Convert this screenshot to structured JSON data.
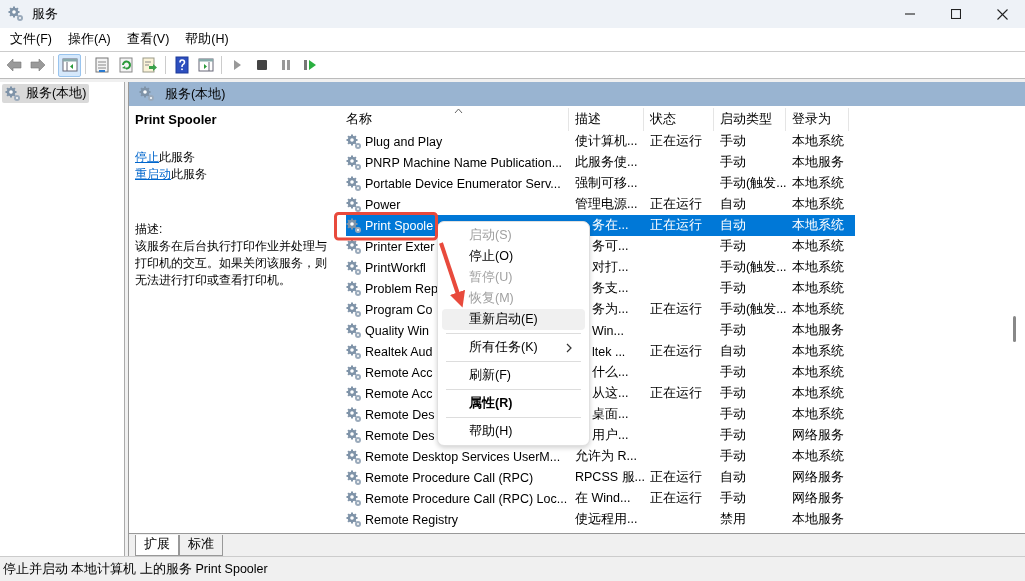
{
  "window": {
    "title": "服务"
  },
  "menu_bar": [
    {
      "label": "文件(F)"
    },
    {
      "label": "操作(A)"
    },
    {
      "label": "查看(V)"
    },
    {
      "label": "帮助(H)"
    }
  ],
  "toolbar": [
    {
      "kind": "back",
      "selected": false
    },
    {
      "kind": "forward",
      "selected": false
    },
    {
      "kind": "separator"
    },
    {
      "kind": "tree",
      "selected": true
    },
    {
      "kind": "separator"
    },
    {
      "kind": "properties",
      "selected": false
    },
    {
      "kind": "refresh",
      "selected": false
    },
    {
      "kind": "export",
      "selected": false
    },
    {
      "kind": "separator"
    },
    {
      "kind": "help",
      "selected": false
    },
    {
      "kind": "panel",
      "selected": false
    },
    {
      "kind": "separator"
    },
    {
      "kind": "play",
      "selected": false
    },
    {
      "kind": "stop",
      "selected": false
    },
    {
      "kind": "pause",
      "selected": false
    },
    {
      "kind": "resume",
      "selected": false
    }
  ],
  "tree": {
    "items": [
      {
        "label": "服务(本地)",
        "selected": true
      }
    ]
  },
  "panel_header": "服务(本地)",
  "detail": {
    "title": "Print Spooler",
    "actions": [
      {
        "link": "停止",
        "text": "此服务"
      },
      {
        "link": "重启动",
        "text": "此服务"
      }
    ],
    "description_label": "描述:",
    "description": "该服务在后台执行打印作业并处理与打印机的交互。如果关闭该服务，则无法进行打印或查看打印机。"
  },
  "table": {
    "columns": [
      {
        "label": "名称",
        "sorted": true
      },
      {
        "label": "描述",
        "sorted": false
      },
      {
        "label": "状态",
        "sorted": false
      },
      {
        "label": "启动类型",
        "sorted": false
      },
      {
        "label": "登录为",
        "sorted": false
      }
    ],
    "rows": [
      {
        "cells": [
          "Plug and Play",
          "使计算机...",
          "正在运行",
          "手动",
          "本地系统"
        ],
        "selected": false
      },
      {
        "cells": [
          "PNRP Machine Name Publication...",
          "此服务使...",
          "",
          "手动",
          "本地服务"
        ],
        "selected": false
      },
      {
        "cells": [
          "Portable Device Enumerator Serv...",
          "强制可移...",
          "",
          "手动(触发...",
          "本地系统"
        ],
        "selected": false
      },
      {
        "cells": [
          "Power",
          "管理电源...",
          "正在运行",
          "自动",
          "本地系统"
        ],
        "selected": false
      },
      {
        "cells": [
          "Print Spoole",
          "务在...",
          "正在运行",
          "自动",
          "本地系统"
        ],
        "selected": true
      },
      {
        "cells": [
          "Printer Exter",
          "务可...",
          "",
          "手动",
          "本地系统"
        ],
        "selected": false
      },
      {
        "cells": [
          "PrintWorkfl",
          "对打...",
          "",
          "手动(触发...",
          "本地系统"
        ],
        "selected": false
      },
      {
        "cells": [
          "Problem Rep",
          "务支...",
          "",
          "手动",
          "本地系统"
        ],
        "selected": false
      },
      {
        "cells": [
          "Program Co",
          "务为...",
          "正在运行",
          "手动(触发...",
          "本地系统"
        ],
        "selected": false
      },
      {
        "cells": [
          "Quality Win",
          "Win...",
          "",
          "手动",
          "本地服务"
        ],
        "selected": false
      },
      {
        "cells": [
          "Realtek Aud",
          "ltek ...",
          "正在运行",
          "自动",
          "本地系统"
        ],
        "selected": false
      },
      {
        "cells": [
          "Remote Acc",
          "什么...",
          "",
          "手动",
          "本地系统"
        ],
        "selected": false
      },
      {
        "cells": [
          "Remote Acc",
          "从这...",
          "正在运行",
          "手动",
          "本地系统"
        ],
        "selected": false
      },
      {
        "cells": [
          "Remote Des",
          "桌面...",
          "",
          "手动",
          "本地系统"
        ],
        "selected": false
      },
      {
        "cells": [
          "Remote Des",
          "用户...",
          "",
          "手动",
          "网络服务"
        ],
        "selected": false
      },
      {
        "cells": [
          "Remote Desktop Services UserM...",
          "允许为 R...",
          "",
          "手动",
          "本地系统"
        ],
        "selected": false
      },
      {
        "cells": [
          "Remote Procedure Call (RPC)",
          "RPCSS 服...",
          "正在运行",
          "自动",
          "网络服务"
        ],
        "selected": false
      },
      {
        "cells": [
          "Remote Procedure Call (RPC) Loc...",
          "在 Wind...",
          "正在运行",
          "手动",
          "网络服务"
        ],
        "selected": false
      },
      {
        "cells": [
          "Remote Registry",
          "使远程用...",
          "",
          "禁用",
          "本地服务"
        ],
        "selected": false
      }
    ]
  },
  "context_menu": {
    "items": [
      {
        "kind": "item",
        "label": "启动(S)",
        "disabled": true,
        "highlighted": false,
        "submenu": false,
        "default": false
      },
      {
        "kind": "item",
        "label": "停止(O)",
        "disabled": false,
        "highlighted": false,
        "submenu": false,
        "default": false
      },
      {
        "kind": "item",
        "label": "暂停(U)",
        "disabled": true,
        "highlighted": false,
        "submenu": false,
        "default": false
      },
      {
        "kind": "item",
        "label": "恢复(M)",
        "disabled": true,
        "highlighted": false,
        "submenu": false,
        "default": false
      },
      {
        "kind": "item",
        "label": "重新启动(E)",
        "disabled": false,
        "highlighted": true,
        "submenu": false,
        "default": false
      },
      {
        "kind": "separator"
      },
      {
        "kind": "item",
        "label": "所有任务(K)",
        "disabled": false,
        "highlighted": false,
        "submenu": true,
        "default": false
      },
      {
        "kind": "separator"
      },
      {
        "kind": "item",
        "label": "刷新(F)",
        "disabled": false,
        "highlighted": false,
        "submenu": false,
        "default": false
      },
      {
        "kind": "separator"
      },
      {
        "kind": "item",
        "label": "属性(R)",
        "disabled": false,
        "highlighted": false,
        "submenu": false,
        "default": true
      },
      {
        "kind": "separator"
      },
      {
        "kind": "item",
        "label": "帮助(H)",
        "disabled": false,
        "highlighted": false,
        "submenu": false,
        "default": false
      }
    ]
  },
  "view_tabs": [
    {
      "label": "扩展",
      "selected": true
    },
    {
      "label": "标准",
      "selected": false
    }
  ],
  "status_bar": "停止并启动 本地计算机 上的服务 Print Spooler"
}
